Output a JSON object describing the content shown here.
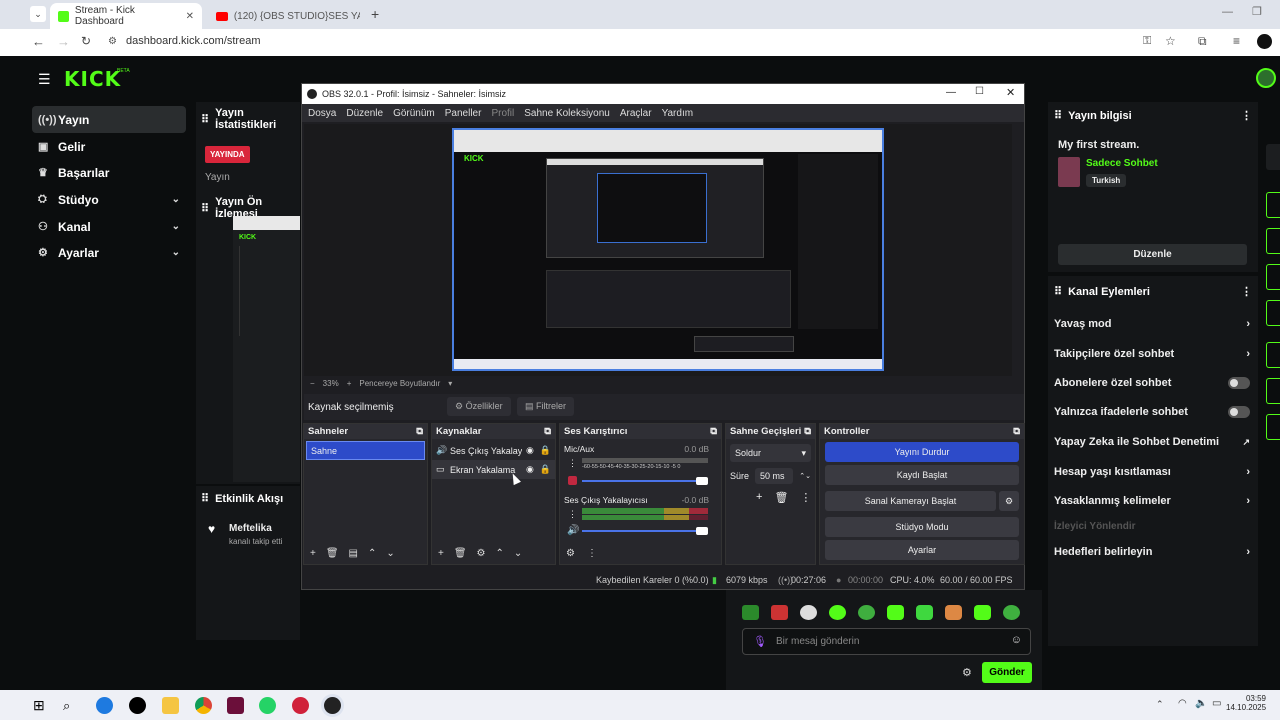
{
  "browser": {
    "tabs": [
      {
        "label": "Stream - Kick Dashboard",
        "active": true
      },
      {
        "label": "(120) {OBS STUDIO}SES YANKI ...",
        "active": false
      }
    ],
    "url": "dashboard.kick.com/stream"
  },
  "kick": {
    "logo": "KICK",
    "logo_badge": "BETA",
    "nav": [
      {
        "label": "Yayın",
        "icon": "broadcast-icon",
        "active": true
      },
      {
        "label": "Gelir",
        "icon": "wallet-icon"
      },
      {
        "label": "Başarılar",
        "icon": "trophy-icon"
      },
      {
        "label": "Stüdyo",
        "icon": "studio-icon",
        "expandable": true
      },
      {
        "label": "Kanal",
        "icon": "channel-icon",
        "expandable": true
      },
      {
        "label": "Ayarlar",
        "icon": "gear-icon",
        "expandable": true
      }
    ],
    "stats_title": "Yayın İstatistikleri",
    "live_badge": "YAYINDA",
    "stream_label": "Yayın",
    "preview_title": "Yayın Ön İzlemesi",
    "activity_title": "Etkinlik Akışı",
    "activity": [
      {
        "user": "Meftelika",
        "text": "kanalı takip etti"
      }
    ],
    "stream_info": {
      "title": "Yayın bilgisi",
      "stream_title": "My first stream.",
      "category": "Sadece Sohbet",
      "language": "Turkish",
      "edit_button": "Düzenle"
    },
    "channel_actions": {
      "title": "Kanal Eylemleri",
      "items": [
        {
          "label": "Yavaş mod",
          "control": "chevron"
        },
        {
          "label": "Takipçilere özel sohbet",
          "control": "chevron"
        },
        {
          "label": "Abonelere özel sohbet",
          "control": "toggle"
        },
        {
          "label": "Yalnızca ifadelerle sohbet",
          "control": "toggle"
        },
        {
          "label": "Yapay Zeka ile Sohbet Denetimi",
          "control": "external"
        },
        {
          "label": "Hesap yaşı kısıtlaması",
          "control": "chevron"
        },
        {
          "label": "Yasaklanmış kelimeler",
          "control": "chevron"
        },
        {
          "label": "İzleyici Yönlendir",
          "control": "none",
          "disabled": true
        },
        {
          "label": "Hedefleri belirleyin",
          "control": "chevron"
        }
      ]
    },
    "chat": {
      "placeholder": "Bir mesaj gönderin",
      "send_button": "Gönder"
    }
  },
  "obs": {
    "title": "OBS 32.0.1 - Profil: İsimsiz - Sahneler: İsimsiz",
    "menu": [
      "Dosya",
      "Düzenle",
      "Görünüm",
      "Paneller",
      "Profil",
      "Sahne Koleksiyonu",
      "Araçlar",
      "Yardım"
    ],
    "zoom": "33%",
    "resize_label": "Pencereye Boyutlandır",
    "no_source": "Kaynak seçilmemiş",
    "properties_button": "Özellikler",
    "filters_button": "Filtreler",
    "scenes": {
      "title": "Sahneler",
      "items": [
        "Sahne"
      ]
    },
    "sources": {
      "title": "Kaynaklar",
      "items": [
        "Ses Çıkış Yakalay",
        "Ekran Yakalama"
      ]
    },
    "mixer": {
      "title": "Ses Karıştırıcı",
      "channels": [
        {
          "name": "Mic/Aux",
          "db": "0.0 dB",
          "muted": true,
          "volume": 0.95
        },
        {
          "name": "Ses Çıkış Yakalayıcısı",
          "db": "-0.0 dB",
          "muted": false,
          "volume": 0.95
        }
      ],
      "scale": "-60-55-50-45-40-35-30-25-20-15-10 -5  0"
    },
    "transitions": {
      "title": "Sahne Geçişleri",
      "type": "Soldur",
      "duration_label": "Süre",
      "duration": "50 ms"
    },
    "controls": {
      "title": "Kontroller",
      "buttons": [
        "Yayını Durdur",
        "Kaydı Başlat",
        "Sanal Kamerayı Başlat",
        "Stüdyo Modu",
        "Ayarlar"
      ]
    },
    "status": {
      "dropped": "Kaybedilen Kareler 0 (%0.0)",
      "bitrate": "6079 kbps",
      "stream_time": "00:27:06",
      "rec_time": "00:00:00",
      "cpu": "CPU: 4.0%",
      "fps": "60.00 / 60.00 FPS"
    }
  },
  "taskbar": {
    "time": "03:59",
    "date": "14.10.2025"
  }
}
